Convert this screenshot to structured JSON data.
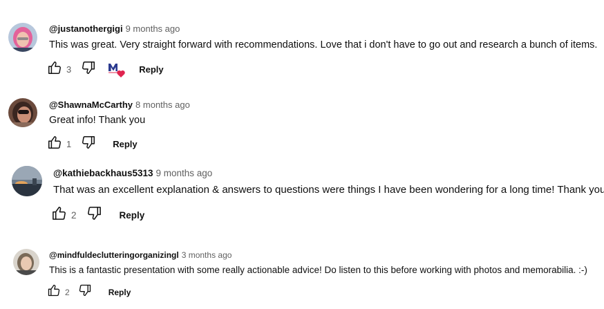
{
  "comments": [
    {
      "author": "@justanothergigi",
      "time": "9 months ago",
      "text": "This was great. Very straight forward with recommendations. Love that i don't have to go out and research a bunch of items.",
      "likes": "3",
      "reply_label": "Reply",
      "creator_heart": true,
      "avatar_colors": {
        "bg": "#b7c7dc",
        "hair": "#e3629a",
        "face": "#f0c2b0"
      }
    },
    {
      "author": "@ShawnaMcCarthy",
      "time": "8 months ago",
      "text": "Great info! Thank you",
      "likes": "1",
      "reply_label": "Reply",
      "creator_heart": false,
      "avatar_colors": {
        "bg": "#6b4a3c",
        "hair": "#3a2620",
        "face": "#c98e76"
      }
    },
    {
      "author": "@kathiebackhaus5313",
      "time": "9 months ago",
      "text": "That was an excellent explanation & answers to questions were things I have been wondering for a long time! Thank you!",
      "likes": "2",
      "reply_label": "Reply",
      "creator_heart": false,
      "avatar_colors": {
        "bg": "#6f7d8c",
        "hair": "#2b3440",
        "face": "#e4a35a"
      }
    },
    {
      "author": "@mindfuldeclutteringorganizingl",
      "time": "3 months ago",
      "text": "This is a fantastic presentation with some really actionable advice!  Do listen to this before working with photos and memorabilia. :-)",
      "likes": "2",
      "reply_label": "Reply",
      "creator_heart": false,
      "avatar_colors": {
        "bg": "#d9d4cc",
        "hair": "#7a6a58",
        "face": "#e9c9b2"
      }
    }
  ],
  "icons": {
    "like": "thumbs-up-icon",
    "dislike": "thumbs-down-icon",
    "heart_badge": "creator-heart-icon"
  },
  "colors": {
    "text": "#0f0f0f",
    "secondary": "#606060",
    "heart": "#e0244f",
    "creator_logo": "#2b3a8f"
  }
}
